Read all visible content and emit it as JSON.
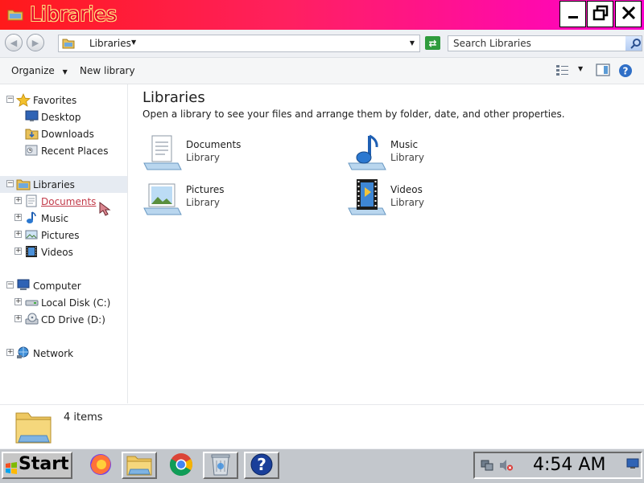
{
  "window": {
    "title": "Libraries",
    "minimize_icon": "minimize-icon",
    "maximize_icon": "restore-icon",
    "close_icon": "close-icon"
  },
  "address_bar": {
    "path": "Libraries",
    "search_placeholder": "Search Libraries"
  },
  "toolbar": {
    "organize": "Organize",
    "new_library": "New library"
  },
  "nav": {
    "favorites": {
      "label": "Favorites",
      "items": [
        "Desktop",
        "Downloads",
        "Recent Places"
      ]
    },
    "libraries": {
      "label": "Libraries",
      "items": [
        "Documents",
        "Music",
        "Pictures",
        "Videos"
      ]
    },
    "computer": {
      "label": "Computer",
      "items": [
        "Local Disk (C:)",
        "CD Drive (D:)"
      ]
    },
    "network": {
      "label": "Network"
    }
  },
  "content": {
    "title": "Libraries",
    "description": "Open a library to see your files and arrange them by folder, date, and other properties.",
    "libraries": [
      {
        "name": "Documents",
        "type": "Library",
        "icon": "documents-library-icon"
      },
      {
        "name": "Music",
        "type": "Library",
        "icon": "music-library-icon"
      },
      {
        "name": "Pictures",
        "type": "Library",
        "icon": "pictures-library-icon"
      },
      {
        "name": "Videos",
        "type": "Library",
        "icon": "videos-library-icon"
      }
    ]
  },
  "status": {
    "item_count": "4 items"
  },
  "taskbar": {
    "start_label": "Start",
    "clock": "4:54 AM",
    "apps": [
      "firefox-icon",
      "file-explorer-icon",
      "chrome-icon",
      "recycle-bin-icon",
      "help-icon"
    ]
  },
  "colors": {
    "title_gradient_start": "#ff1a1a",
    "title_gradient_end": "#ff00cc",
    "title_text": "#e8002a",
    "link_text": "#c23b4a",
    "taskbar": "#c3c7cc"
  }
}
